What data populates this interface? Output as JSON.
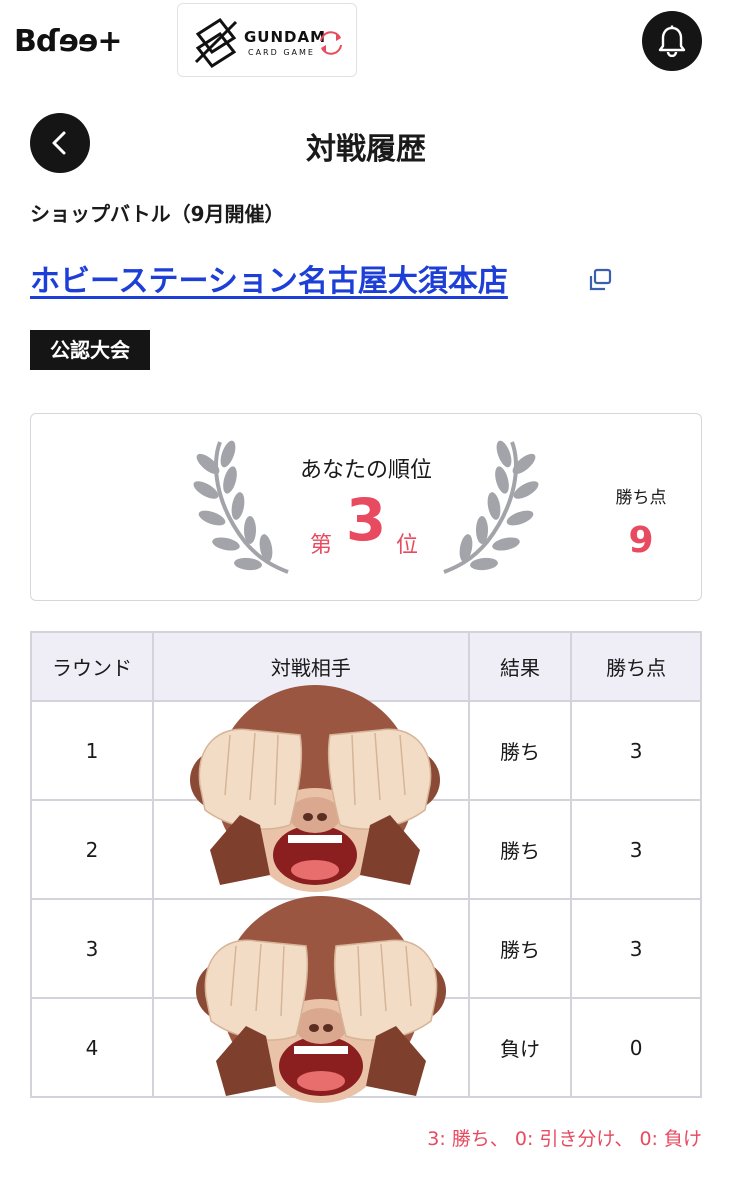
{
  "header": {
    "brand": "Bɗɘɘ+",
    "game_title": "GUNDAM",
    "game_subtitle": "CARD GAME"
  },
  "page": {
    "title": "対戦履歴",
    "event_title": "ショップバトル（9月開催）",
    "venue": "ホビーステーション名古屋大須本店",
    "tag": "公認大会"
  },
  "ranking": {
    "label": "あなたの順位",
    "prefix": "第",
    "rank": "3",
    "suffix": "位",
    "points_label": "勝ち点",
    "points": "9"
  },
  "table": {
    "headers": [
      "ラウンド",
      "対戦相手",
      "結果",
      "勝ち点"
    ],
    "rows": [
      {
        "round": "1",
        "opponent": "",
        "result": "勝ち",
        "points": "3"
      },
      {
        "round": "2",
        "opponent": "",
        "result": "勝ち",
        "points": "3"
      },
      {
        "round": "3",
        "opponent": "",
        "result": "勝ち",
        "points": "3"
      },
      {
        "round": "4",
        "opponent": "",
        "result": "負け",
        "points": "0"
      }
    ]
  },
  "legend": "3: 勝ち、 0: 引き分け、 0: 負け",
  "colors": {
    "accent": "#e84a5f",
    "link": "#1d3fd8",
    "dark": "#151515",
    "table_header_bg": "#efeef7"
  },
  "icons": [
    "bell-icon",
    "back-arrow-icon",
    "external-link-icon",
    "laurel-icon",
    "swap-icon"
  ]
}
